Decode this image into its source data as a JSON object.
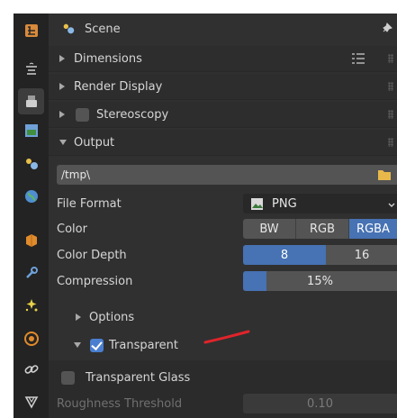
{
  "header": {
    "title": "Scene"
  },
  "sections": {
    "dimensions": "Dimensions",
    "render_display": "Render Display",
    "stereoscopy": "Stereoscopy",
    "output": "Output"
  },
  "output": {
    "path": "/tmp\\",
    "file_format_label": "File Format",
    "file_format_value": "PNG",
    "color_label": "Color",
    "color_options": [
      "BW",
      "RGB",
      "RGBA"
    ],
    "color_selected": "RGBA",
    "color_depth_label": "Color Depth",
    "color_depth_options": [
      "8",
      "16"
    ],
    "color_depth_selected": "8",
    "compression_label": "Compression",
    "compression_value": "15%",
    "compression_fraction": 0.15,
    "options_label": "Options",
    "transparent_label": "Transparent",
    "transparent_checked": true
  },
  "transparent_glass": {
    "label": "Transparent Glass",
    "checked": false,
    "roughness_label": "Roughness Threshold",
    "roughness_value": "0.10"
  },
  "colors": {
    "accent": "#4772b3",
    "annotation": "#e0242a"
  }
}
